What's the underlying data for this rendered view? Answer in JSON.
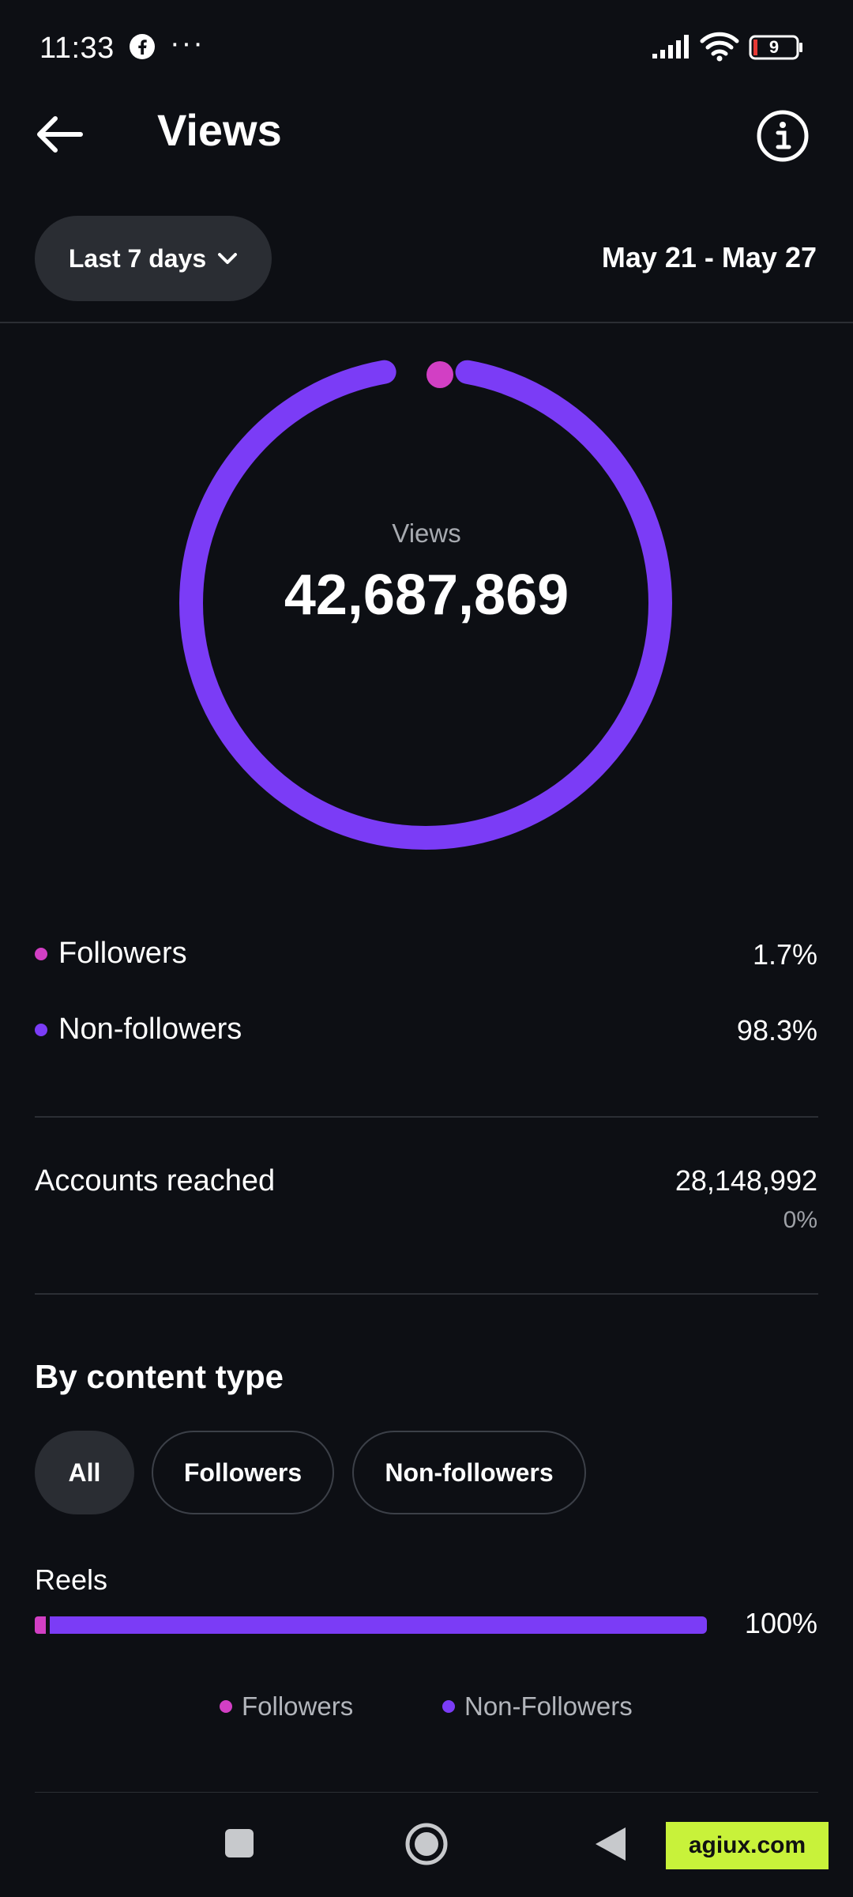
{
  "status_bar": {
    "time": "11:33",
    "notification_icon": "facebook-icon",
    "more": "···",
    "battery_level": "9"
  },
  "header": {
    "title": "Views",
    "back_icon": "arrow-left-icon",
    "info_icon": "info-circle-icon"
  },
  "filters": {
    "range_label": "Last 7 days",
    "date_range": "May 21 - May 27"
  },
  "summary": {
    "label": "Views",
    "total": "42,687,869",
    "followers_share": 1.7,
    "non_followers_share": 98.3
  },
  "audience": [
    {
      "label": "Followers",
      "value": "1.7%",
      "color": "#d23fc4"
    },
    {
      "label": "Non-followers",
      "value": "98.3%",
      "color": "#7b3cf6"
    }
  ],
  "accounts_reached": {
    "label": "Accounts reached",
    "value": "28,148,992",
    "change": "0%"
  },
  "content_type": {
    "title": "By content type",
    "tabs": [
      "All",
      "Followers",
      "Non-followers"
    ],
    "active_tab": "All",
    "rows": [
      {
        "label": "Reels",
        "value": "100%",
        "followers_fraction": 0.017,
        "non_followers_fraction": 0.983
      }
    ],
    "legend": [
      {
        "label": "Followers",
        "color": "#d23fc4"
      },
      {
        "label": "Non-Followers",
        "color": "#7b3cf6"
      }
    ]
  },
  "watermark": "agiux.com",
  "colors": {
    "background": "#0d0f14",
    "followers": "#d23fc4",
    "non_followers": "#7b3cf6",
    "chip": "#2a2d33"
  }
}
